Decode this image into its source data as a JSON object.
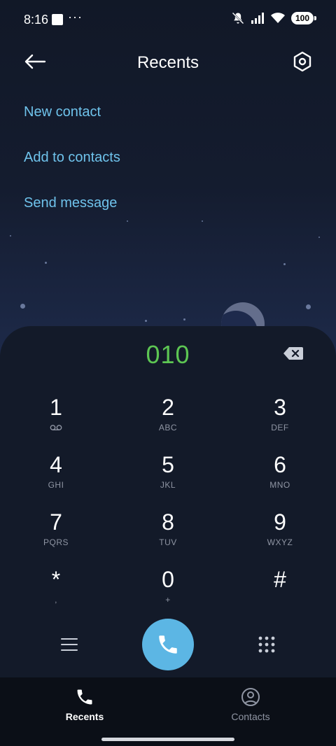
{
  "status_bar": {
    "time": "8:16",
    "dots": "···",
    "battery": "100",
    "icons": [
      "mute-bell-icon",
      "signal-icon",
      "wifi-icon",
      "battery-icon"
    ]
  },
  "header": {
    "title": "Recents",
    "back_icon": "arrow-left-icon",
    "settings_icon": "hexagon-settings-icon"
  },
  "actions": [
    {
      "label": "New contact"
    },
    {
      "label": "Add to contacts"
    },
    {
      "label": "Send message"
    }
  ],
  "dialer": {
    "number": "010",
    "number_color": "#5dc653",
    "keys": [
      {
        "digit": "1",
        "letters": ""
      },
      {
        "digit": "2",
        "letters": "ABC"
      },
      {
        "digit": "3",
        "letters": "DEF"
      },
      {
        "digit": "4",
        "letters": "GHI"
      },
      {
        "digit": "5",
        "letters": "JKL"
      },
      {
        "digit": "6",
        "letters": "MNO"
      },
      {
        "digit": "7",
        "letters": "PQRS"
      },
      {
        "digit": "8",
        "letters": "TUV"
      },
      {
        "digit": "9",
        "letters": "WXYZ"
      },
      {
        "digit": "*",
        "letters": ","
      },
      {
        "digit": "0",
        "letters": "+"
      },
      {
        "digit": "#",
        "letters": ""
      }
    ],
    "call_color": "#5cb6e4"
  },
  "bottom_nav": {
    "tabs": [
      {
        "label": "Recents",
        "icon": "phone-icon",
        "active": true
      },
      {
        "label": "Contacts",
        "icon": "person-circle-icon",
        "active": false
      }
    ]
  },
  "colors": {
    "accent_link": "#6fc3ec",
    "panel": "#131a29"
  }
}
